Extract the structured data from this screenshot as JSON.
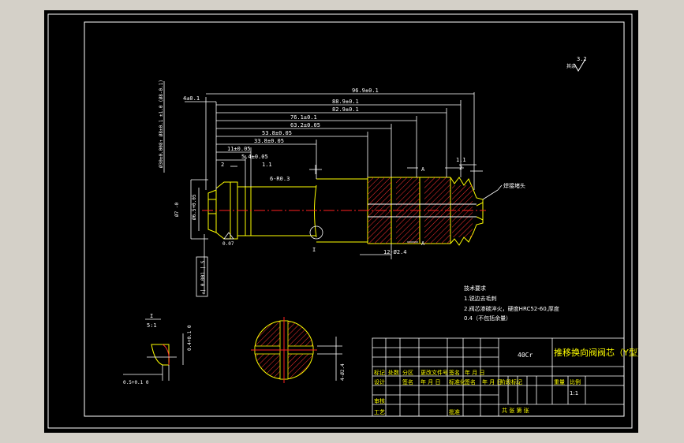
{
  "surface_finish": {
    "symbol_label": "其余",
    "value": "3.2"
  },
  "dims": {
    "d1": "96.9±0.1",
    "d2": "88.9±0.1",
    "d3": "82.9±0.1",
    "d4": "76.1±0.1",
    "d5": "63.2±0.05",
    "d6": "53.8±0.05",
    "d7": "33.8±0.05",
    "d8": "11±0.05",
    "d9": "5.4±0.05",
    "left_offset": "4±0.1",
    "small_2a": "2",
    "small_11a": "1.1",
    "small_11b": "1.1",
    "small_2b": "2",
    "radius": "6-R0.3",
    "holes": "12-Ø2.4",
    "section_a_top": "A",
    "section_a_bottom": "A",
    "detail_ref": "I",
    "vertical_top": "Ø30±0.008↑ Ø8±0.1  ±1.0  (Ø8-0.1)",
    "left_dia1": "Ø7 -0",
    "left_dia2": "Ø6.5+0.05",
    "perp": "0.07",
    "runout_box": "↗| 0.001 | S",
    "detail_scale_1": "I",
    "detail_scale_2": "5:1",
    "detail_dim_top": "0.4+0.1 0",
    "detail_dim_bottom": "0.5+0.1 0",
    "section_dim": "4-Ø2.4"
  },
  "notes": {
    "title": "技术要求",
    "line1": "1.锐边去毛刺",
    "line2": "2.阀芯渗碳淬火，硬度HRC52-60,厚度",
    "line3": "0.4（不包括余量）"
  },
  "weld_label": "焊接堵头",
  "title_block": {
    "material": "40Cr",
    "drawing_name": "推移换向阀阀芯（Y型）",
    "r1": [
      "标记",
      "处数",
      "分区",
      "更改文件号",
      "签名",
      "年 月 日"
    ],
    "r2": [
      "设计",
      "签名",
      "年 月 日",
      "标准化",
      "签名",
      "年 月 日"
    ],
    "r3": [
      "审核",
      "",
      "",
      "",
      "",
      ""
    ],
    "r4": [
      "工艺",
      "",
      "",
      "批准",
      "",
      ""
    ],
    "stage": "阶段标记",
    "weight": "重量",
    "scale": "比例",
    "scale_value": "1:1",
    "sheets": "共 张 第 张"
  }
}
